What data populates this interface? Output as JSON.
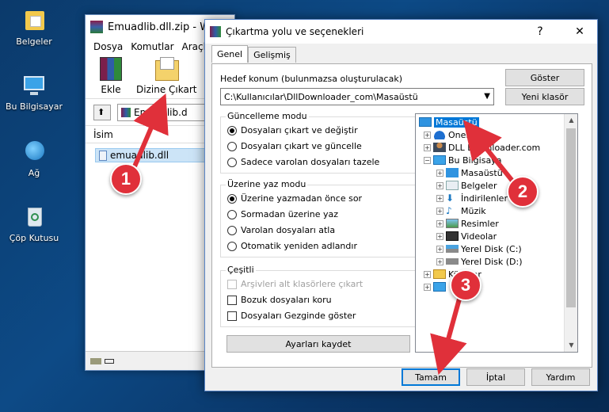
{
  "desktop": {
    "icons": [
      {
        "label": "Belgeler",
        "icon": "folder-documents-icon"
      },
      {
        "label": "Bu Bilgisayar",
        "icon": "computer-icon"
      },
      {
        "label": "Ağ",
        "icon": "network-icon"
      },
      {
        "label": "Çöp Kutusu",
        "icon": "recycle-bin-icon"
      }
    ]
  },
  "winrar": {
    "title": "Emuadlib.dll.zip - W",
    "menu": [
      "Dosya",
      "Komutlar",
      "Araçla"
    ],
    "tools": {
      "add": "Ekle",
      "extract_to": "Dizine Çıkart"
    },
    "address": "Emuadlib.d",
    "list_header": "İsim",
    "file": "emuadlib.dll"
  },
  "dialog": {
    "title": "Çıkartma yolu ve seçenekleri",
    "help": "?",
    "close": "✕",
    "tabs": [
      "Genel",
      "Gelişmiş"
    ],
    "dest_label": "Hedef konum (bulunmazsa oluşturulacak)",
    "dest_value": "C:\\Kullanıcılar\\DllDownloader_com\\Masaüstü",
    "show_button": "Göster",
    "new_folder_button": "Yeni klasör",
    "update_mode": {
      "title": "Güncelleme modu",
      "options": [
        "Dosyaları çıkart ve değiştir",
        "Dosyaları çıkart ve güncelle",
        "Sadece varolan dosyaları tazele"
      ],
      "selected": 0
    },
    "overwrite_mode": {
      "title": "Üzerine yaz modu",
      "options": [
        "Üzerine yazmadan önce sor",
        "Sormadan üzerine yaz",
        "Varolan dosyaları atla",
        "Otomatik yeniden adlandır"
      ],
      "selected": 0
    },
    "misc": {
      "title": "Çeşitli",
      "options": [
        "Arşivleri alt klasörlere çıkart",
        "Bozuk dosyaları koru",
        "Dosyaları Gezginde göster"
      ]
    },
    "save_settings": "Ayarları kaydet",
    "tree": {
      "root": "Masaüstü",
      "items": [
        "OneDri",
        "DLL Downloader.com",
        "Bu Bilgisaya",
        "Masaüstü",
        "Belgeler",
        "İndirilenler",
        "Müzik",
        "Resimler",
        "Videolar",
        "Yerel Disk (C:)",
        "Yerel Disk (D:)",
        "Kü ...lar",
        ""
      ]
    },
    "buttons": {
      "ok": "Tamam",
      "cancel": "İptal",
      "help": "Yardım"
    }
  },
  "annotations": [
    "1",
    "2",
    "3"
  ],
  "colors": {
    "annotation": "#e0303a",
    "selection": "#0078d7"
  }
}
